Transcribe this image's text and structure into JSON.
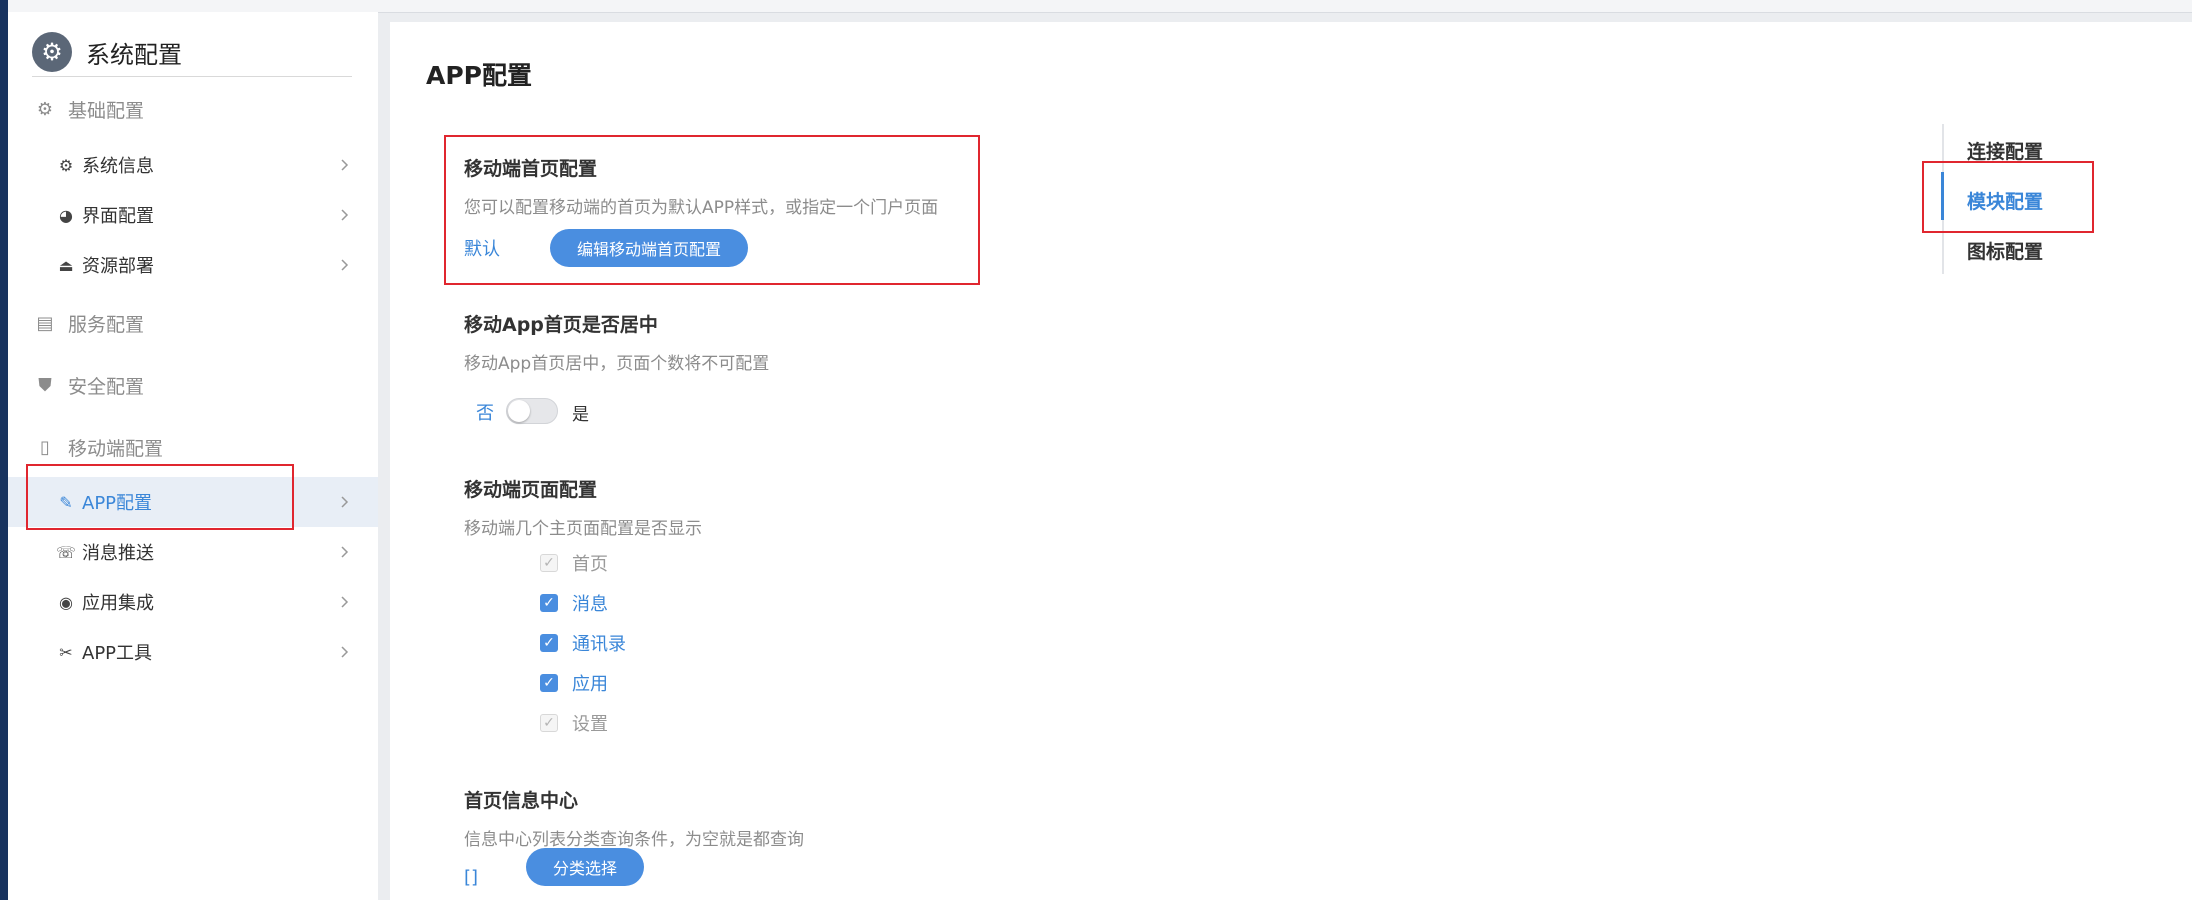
{
  "sidebar": {
    "title": "系统配置",
    "groups": [
      {
        "label": "基础配置",
        "icon": "gear-icon"
      },
      {
        "label": "服务配置",
        "icon": "server-icon"
      },
      {
        "label": "安全配置",
        "icon": "shield-icon"
      },
      {
        "label": "移动端配置",
        "icon": "mobile-icon"
      }
    ],
    "items": [
      {
        "label": "系统信息",
        "icon": "gear-icon"
      },
      {
        "label": "界面配置",
        "icon": "palette-icon"
      },
      {
        "label": "资源部署",
        "icon": "deploy-icon"
      },
      {
        "label": "APP配置",
        "icon": "plug-icon",
        "active": true
      },
      {
        "label": "消息推送",
        "icon": "message-icon"
      },
      {
        "label": "应用集成",
        "icon": "compass-icon"
      },
      {
        "label": "APP工具",
        "icon": "tools-icon"
      }
    ]
  },
  "main": {
    "page_title": "APP配置",
    "home_config": {
      "title": "移动端首页配置",
      "desc": "您可以配置移动端的首页为默认APP样式，或指定一个门户页面",
      "current": "默认",
      "button": "编辑移动端首页配置"
    },
    "center_config": {
      "title": "移动App首页是否居中",
      "desc": "移动App首页居中，页面个数将不可配置",
      "off_label": "否",
      "on_label": "是",
      "value": false
    },
    "pages_config": {
      "title": "移动端页面配置",
      "desc": "移动端几个主页面配置是否显示",
      "options": [
        {
          "label": "首页",
          "checked": true,
          "disabled": true
        },
        {
          "label": "消息",
          "checked": true,
          "disabled": false
        },
        {
          "label": "通讯录",
          "checked": true,
          "disabled": false
        },
        {
          "label": "应用",
          "checked": true,
          "disabled": false
        },
        {
          "label": "设置",
          "checked": true,
          "disabled": true
        }
      ]
    },
    "info_center": {
      "title": "首页信息中心",
      "desc": "信息中心列表分类查询条件，为空就是都查询",
      "value": "[]",
      "button": "分类选择"
    }
  },
  "anchor_nav": {
    "items": [
      "连接配置",
      "模块配置",
      "图标配置"
    ],
    "active_index": 1
  },
  "colors": {
    "accent": "#3a86d8",
    "highlight_box": "#e0262f"
  }
}
